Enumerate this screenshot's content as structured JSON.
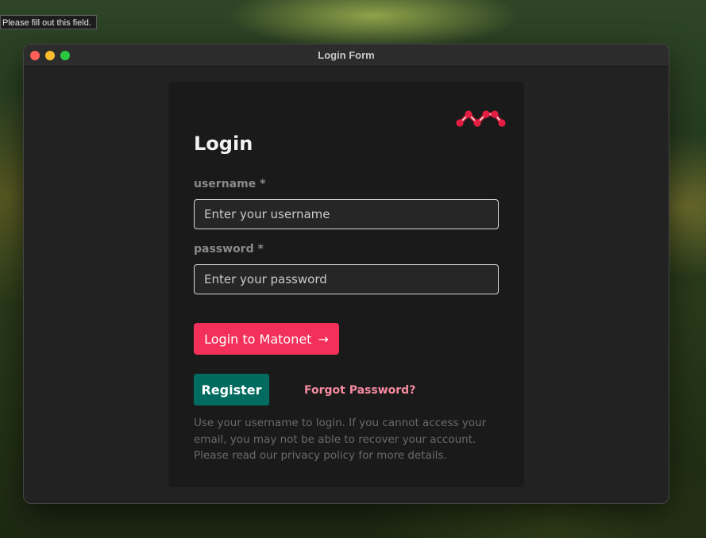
{
  "tooltip": {
    "text": "Please fill out this field."
  },
  "window": {
    "title": "Login Form"
  },
  "card": {
    "title": "Login",
    "username": {
      "label": "username *",
      "placeholder": "Enter your username",
      "value": ""
    },
    "password": {
      "label": "password *",
      "placeholder": "Enter your password",
      "value": ""
    },
    "login_button": {
      "label": "Login to Matonet",
      "arrow": "→"
    },
    "register_button": {
      "label": "Register"
    },
    "forgot_link": {
      "label": "Forgot Password?"
    },
    "help_text": "Use your username to login. If you cannot access your email, you may not be able to recover your account. Please read our privacy policy for more details."
  },
  "icons": {
    "logo": "matonet-logo-icon"
  },
  "colors": {
    "accent": "#f2305a",
    "register": "#006b5e",
    "forgot_link": "#f58aa0",
    "card_bg": "#1a1a1a",
    "window_bg": "#222222"
  }
}
